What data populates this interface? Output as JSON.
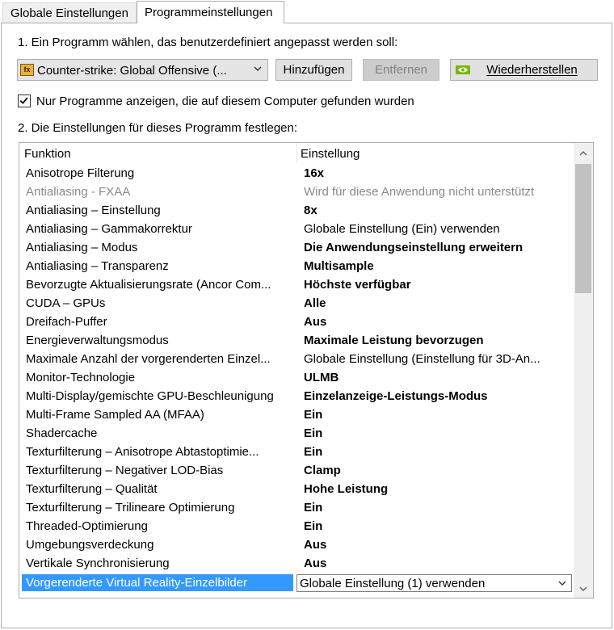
{
  "tabs": [
    {
      "label": "Globale Einstellungen",
      "active": false
    },
    {
      "label": "Programmeinstellungen",
      "active": true
    }
  ],
  "step1": {
    "label": "1. Ein Programm wählen, das benutzerdefiniert angepasst werden soll:"
  },
  "program_select": {
    "value": "Counter-strike: Global Offensive (..."
  },
  "buttons": {
    "add": "Hinzufügen",
    "remove": "Entfernen",
    "restore": "Wiederherstellen"
  },
  "checkbox": {
    "label": "Nur Programme anzeigen, die auf diesem Computer gefunden wurden",
    "checked": true
  },
  "step2": {
    "label": "2. Die Einstellungen für dieses Programm festlegen:"
  },
  "grid": {
    "col_function": "Funktion",
    "col_setting": "Einstellung",
    "rows": [
      {
        "function": "Anisotrope Filterung",
        "setting": "16x",
        "bold": true,
        "disabled": false
      },
      {
        "function": "Antialiasing - FXAA",
        "setting": "Wird für diese Anwendung nicht unterstützt",
        "bold": false,
        "disabled": true
      },
      {
        "function": "Antialiasing – Einstellung",
        "setting": "8x",
        "bold": true,
        "disabled": false
      },
      {
        "function": "Antialiasing – Gammakorrektur",
        "setting": "Globale Einstellung (Ein) verwenden",
        "bold": false,
        "disabled": false
      },
      {
        "function": "Antialiasing – Modus",
        "setting": "Die Anwendungseinstellung erweitern",
        "bold": true,
        "disabled": false
      },
      {
        "function": "Antialiasing – Transparenz",
        "setting": "Multisample",
        "bold": true,
        "disabled": false
      },
      {
        "function": "Bevorzugte Aktualisierungsrate (Ancor Com...",
        "setting": "Höchste verfügbar",
        "bold": true,
        "disabled": false
      },
      {
        "function": "CUDA – GPUs",
        "setting": "Alle",
        "bold": true,
        "disabled": false
      },
      {
        "function": "Dreifach-Puffer",
        "setting": "Aus",
        "bold": true,
        "disabled": false
      },
      {
        "function": "Energieverwaltungsmodus",
        "setting": "Maximale Leistung bevorzugen",
        "bold": true,
        "disabled": false
      },
      {
        "function": "Maximale Anzahl der vorgerenderten Einzel...",
        "setting": "Globale Einstellung (Einstellung für 3D-An...",
        "bold": false,
        "disabled": false
      },
      {
        "function": "Monitor-Technologie",
        "setting": "ULMB",
        "bold": true,
        "disabled": false
      },
      {
        "function": "Multi-Display/gemischte GPU-Beschleunigung",
        "setting": "Einzelanzeige-Leistungs-Modus",
        "bold": true,
        "disabled": false
      },
      {
        "function": "Multi-Frame Sampled AA (MFAA)",
        "setting": "Ein",
        "bold": true,
        "disabled": false
      },
      {
        "function": "Shadercache",
        "setting": "Ein",
        "bold": true,
        "disabled": false
      },
      {
        "function": "Texturfilterung – Anisotrope Abtastoptimie...",
        "setting": "Ein",
        "bold": true,
        "disabled": false
      },
      {
        "function": "Texturfilterung – Negativer LOD-Bias",
        "setting": "Clamp",
        "bold": true,
        "disabled": false
      },
      {
        "function": "Texturfilterung – Qualität",
        "setting": "Hohe Leistung",
        "bold": true,
        "disabled": false
      },
      {
        "function": "Texturfilterung – Trilineare Optimierung",
        "setting": "Ein",
        "bold": true,
        "disabled": false
      },
      {
        "function": "Threaded-Optimierung",
        "setting": "Ein",
        "bold": true,
        "disabled": false
      },
      {
        "function": "Umgebungsverdeckung",
        "setting": "Aus",
        "bold": true,
        "disabled": false
      },
      {
        "function": "Vertikale Synchronisierung",
        "setting": "Aus",
        "bold": true,
        "disabled": false
      },
      {
        "function": "Vorgerenderte Virtual Reality-Einzelbilder",
        "setting": "Globale Einstellung (1) verwenden",
        "bold": false,
        "disabled": false,
        "selected": true
      }
    ]
  },
  "colors": {
    "selection": "#3399ff",
    "nvidia_green": "#76b900",
    "disabled_text": "#8a8a8a"
  }
}
